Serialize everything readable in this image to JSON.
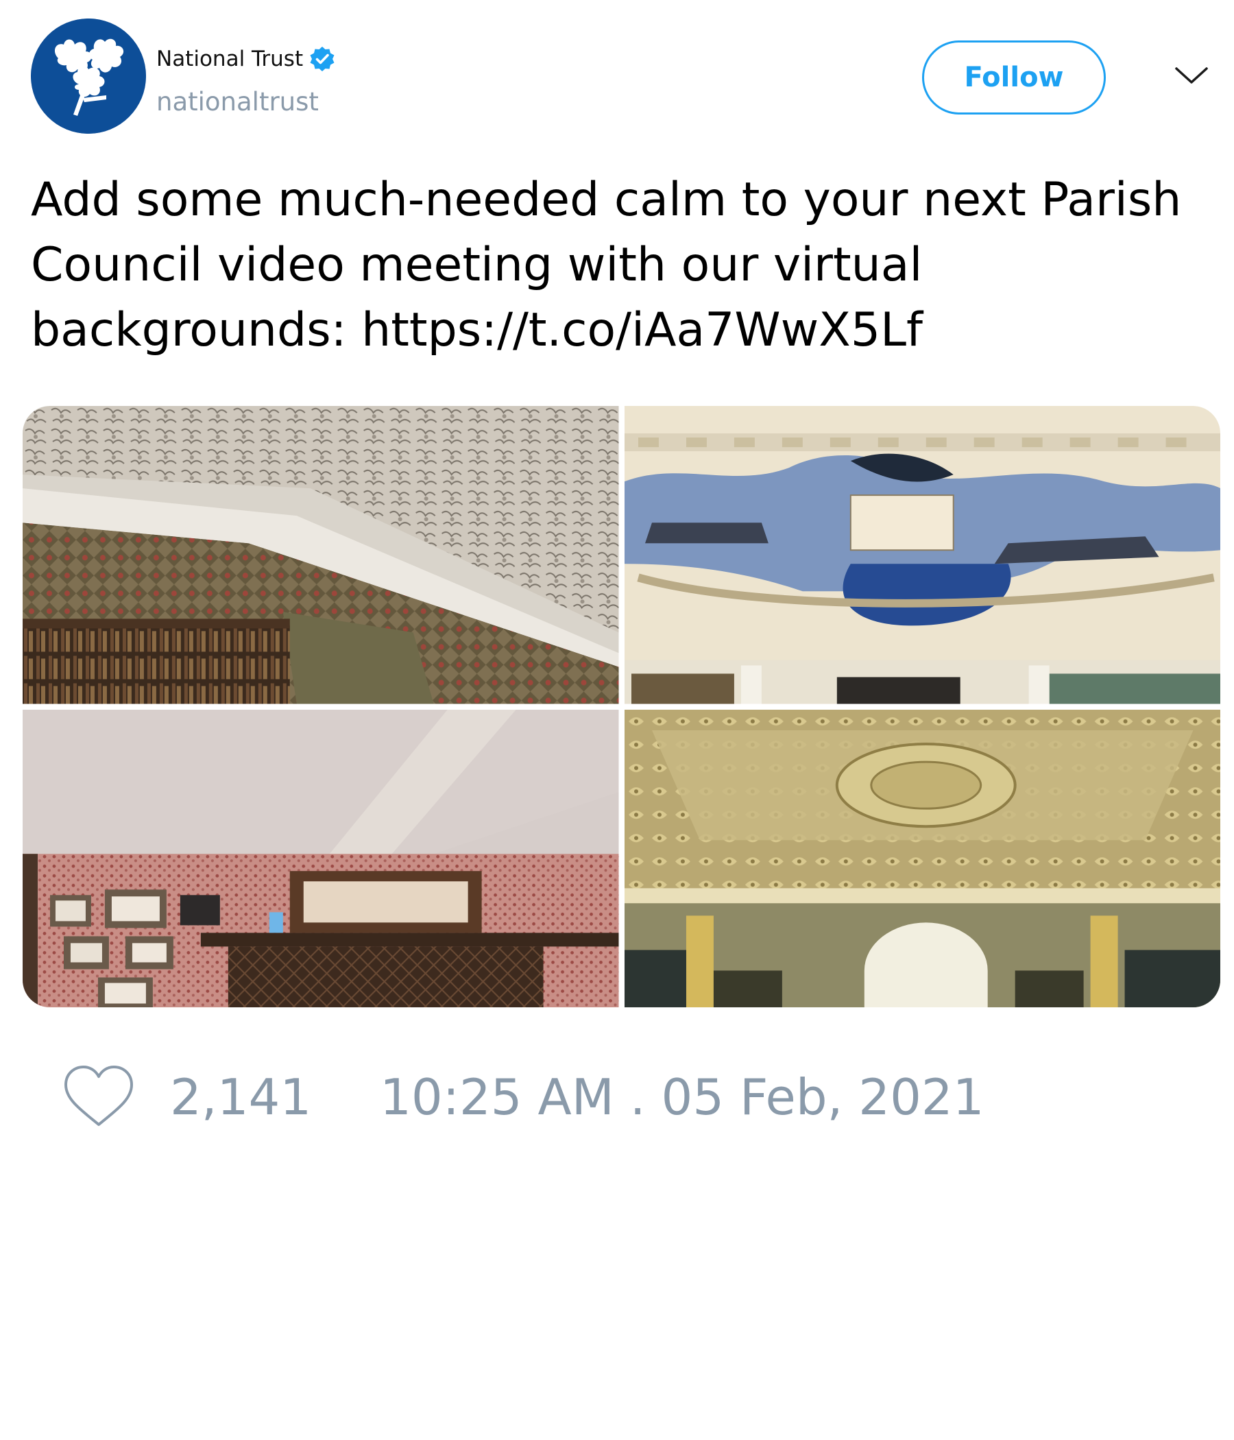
{
  "author": {
    "display_name": "National Trust",
    "handle": "nationaltrust",
    "verified": true,
    "avatar_icon": "oak-leaf-logo-icon",
    "avatar_color": "#0d4e98"
  },
  "actions": {
    "follow_label": "Follow",
    "menu_icon": "chevron-down-icon"
  },
  "tweet": {
    "text": "Add some much-needed calm to your next Parish Council video meeting with our virtual backgrounds: https://t.co/iAa7WwX5Lf"
  },
  "media": [
    {
      "label": "ornate-plaster-ceiling-with-tapestry"
    },
    {
      "label": "painted-mural-above-bookshelves"
    },
    {
      "label": "beamed-room-with-patterned-wallpaper-and-fireplace"
    },
    {
      "label": "gilded-library-ceiling-with-arched-window"
    }
  ],
  "stats": {
    "likes": "2,141",
    "timestamp": "10:25 AM . 05 Feb, 2021"
  },
  "colors": {
    "accent": "#1da1f2",
    "muted": "#8a9aaa"
  }
}
